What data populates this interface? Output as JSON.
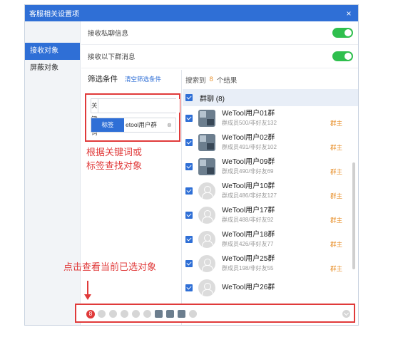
{
  "window": {
    "title": "客服相关设置项",
    "close_icon": "×"
  },
  "sidebar": {
    "items": [
      {
        "label": "接收对象",
        "active": true
      },
      {
        "label": "屏蔽对象",
        "active": false
      }
    ]
  },
  "settings": [
    {
      "label": "接收私聊信息",
      "enabled": true
    },
    {
      "label": "接收以下群消息",
      "enabled": true
    }
  ],
  "filter": {
    "title": "筛选条件",
    "clear_label": "清空筛选条件",
    "keyword_label": "关键词",
    "keyword_value": "",
    "tag_label": "标签",
    "tag_value": "etool用户群",
    "tag_clear_icon": "⊗"
  },
  "results": {
    "prefix": "搜索到",
    "count": "8",
    "suffix": "个结果",
    "group_label": "群聊 (8)",
    "items": [
      {
        "name": "WeTool用户01群",
        "meta": "群成员500/非好友132",
        "role": "群主",
        "avatar": "photo"
      },
      {
        "name": "WeTool用户02群",
        "meta": "群成员491/非好友102",
        "role": "群主",
        "avatar": "photo"
      },
      {
        "name": "WeTool用户09群",
        "meta": "群成员490/非好友69",
        "role": "群主",
        "avatar": "photo"
      },
      {
        "name": "WeTool用户10群",
        "meta": "群成员486/非好友127",
        "role": "群主",
        "avatar": "blank"
      },
      {
        "name": "WeTool用户17群",
        "meta": "群成员488/非好友92",
        "role": "群主",
        "avatar": "blank"
      },
      {
        "name": "WeTool用户18群",
        "meta": "群成员426/非好友77",
        "role": "群主",
        "avatar": "blank"
      },
      {
        "name": "WeTool用户25群",
        "meta": "群成员198/非好友55",
        "role": "群主",
        "avatar": "blank"
      },
      {
        "name": "WeTool用户26群",
        "meta": "",
        "role": "",
        "avatar": "blank"
      }
    ]
  },
  "annotations": {
    "search_hint_line1": "根据关键词或",
    "search_hint_line2": "标签查找对象",
    "selected_hint": "点击查看当前已选对象"
  },
  "selected": {
    "count": "8"
  },
  "colors": {
    "accent": "#2f6fd6",
    "toggle_on": "#2fbf4e",
    "owner_role": "#e8912d",
    "annotation": "#e03a3a"
  }
}
